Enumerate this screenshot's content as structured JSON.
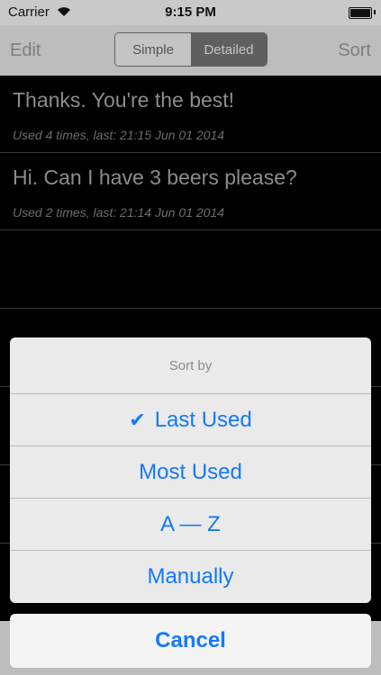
{
  "status": {
    "carrier": "Carrier",
    "time": "9:15 PM"
  },
  "nav": {
    "edit": "Edit",
    "segments": [
      "Simple",
      "Detailed"
    ],
    "selected_segment": "Detailed",
    "sort": "Sort"
  },
  "phrases": [
    {
      "text": "Thanks. You're the best!",
      "usage": "Used 4 times, last: 21:15 Jun 01 2014"
    },
    {
      "text": "Hi. Can I have 3 beers please?",
      "usage": "Used 2 times, last: 21:14 Jun 01 2014"
    }
  ],
  "sheet": {
    "title": "Sort by",
    "options": [
      "Last Used",
      "Most Used",
      "A — Z",
      "Manually"
    ],
    "selected": "Last Used",
    "check_glyph": "✔",
    "cancel": "Cancel"
  },
  "colors": {
    "accent": "#1479fb"
  }
}
